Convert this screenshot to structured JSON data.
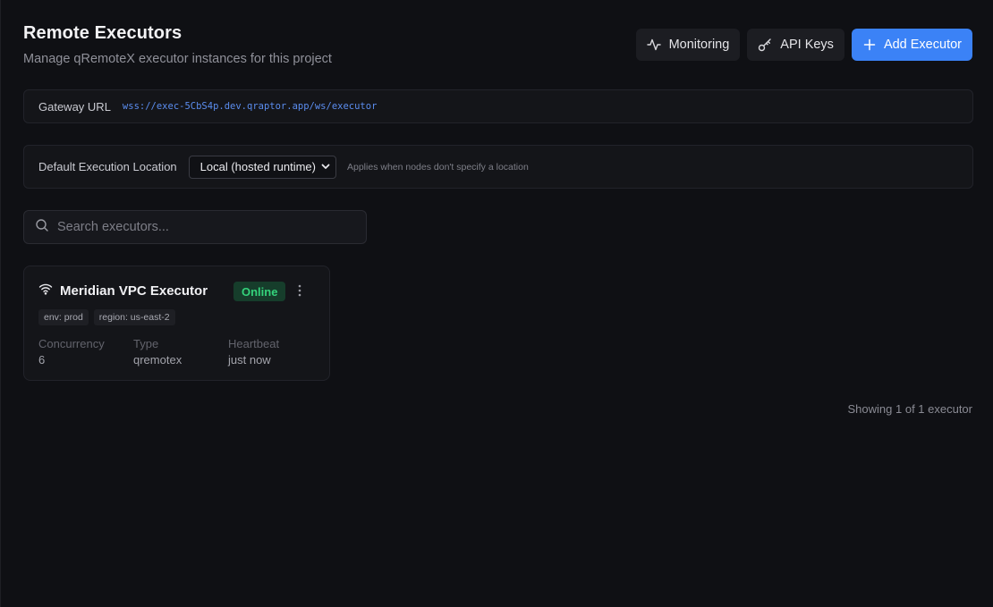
{
  "page": {
    "title": "Remote Executors",
    "subtitle": "Manage qRemoteX executor instances for this project"
  },
  "actions": {
    "monitoring": {
      "label": "Monitoring",
      "icon": "activity-icon"
    },
    "api_keys": {
      "label": "API Keys",
      "icon": "key-icon"
    },
    "add_executor": {
      "label": "Add Executor",
      "icon": "plus-icon"
    }
  },
  "gateway": {
    "label": "Gateway URL",
    "url": "wss://exec-5CbS4p.dev.qraptor.app/ws/executor"
  },
  "execution_location": {
    "label": "Default Execution Location",
    "selected": "Local (hosted runtime)",
    "hint": "Applies when nodes don't specify a location"
  },
  "search": {
    "placeholder": "Search executors..."
  },
  "executors": [
    {
      "name": "Meridian VPC Executor",
      "status": "Online",
      "status_color": "#34d27b",
      "icon": "wifi-icon",
      "tags": [
        "env: prod",
        "region: us-east-2"
      ],
      "stats": [
        {
          "label": "Concurrency",
          "value": "6"
        },
        {
          "label": "Type",
          "value": "qremotex"
        },
        {
          "label": "Heartbeat",
          "value": "just now"
        }
      ]
    }
  ],
  "footer": {
    "count_text": "Showing 1 of 1 executor"
  },
  "colors": {
    "background": "#0f1014",
    "accent": "#3b82f6",
    "link": "#5b8def"
  }
}
